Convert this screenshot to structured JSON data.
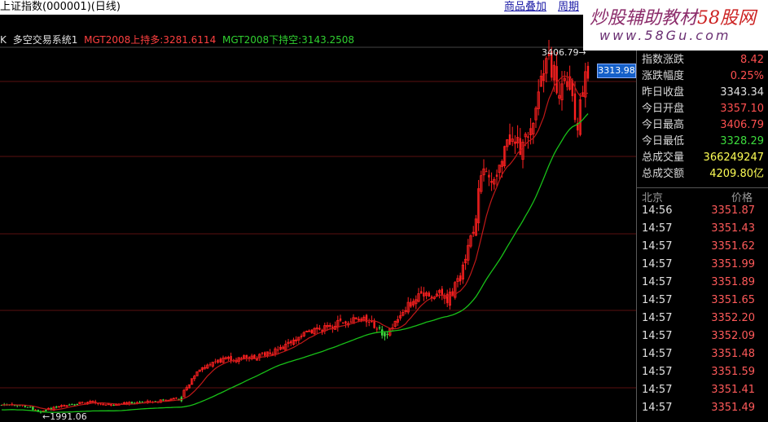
{
  "title_bar": {
    "title": "上证指数(000001)(日线)",
    "overlay_button": "商品叠加",
    "period_button": "周期"
  },
  "indicator": {
    "prefix": "K",
    "name": "多空交易系统1",
    "up_label": "MGT2008上持多:3281.6114",
    "down_label": "MGT2008下持空:3143.2508"
  },
  "chart_labels": {
    "high_marker": "3406.79→",
    "low_marker": "←1991.06",
    "last_price_tag": "3313.98"
  },
  "watermark": {
    "line1_a": "炒股辅助教材",
    "line1_b": "58股网",
    "line2": "www.58Gu.com"
  },
  "stats": [
    {
      "label": "指数涨跌",
      "value": "8.42",
      "color": "#ff5050"
    },
    {
      "label": "涨跌幅度",
      "value": "0.25%",
      "color": "#ff5050"
    },
    {
      "label": "昨日收盘",
      "value": "3343.34",
      "color": "#e0e0e0"
    },
    {
      "label": "今日开盘",
      "value": "3357.10",
      "color": "#ff5050"
    },
    {
      "label": "今日最高",
      "value": "3406.79",
      "color": "#ff5050"
    },
    {
      "label": "今日最低",
      "value": "3328.29",
      "color": "#3ddc3d"
    },
    {
      "label": "总成交量",
      "value": "366249247",
      "color": "#ffff55"
    },
    {
      "label": "总成交额",
      "value": "4209.80亿",
      "color": "#ffff55"
    }
  ],
  "ticks": {
    "header_left": "北京",
    "header_right": "价格",
    "rows": [
      {
        "time": "14:56",
        "price": "3351.87"
      },
      {
        "time": "14:57",
        "price": "3351.43"
      },
      {
        "time": "14:57",
        "price": "3351.62"
      },
      {
        "time": "14:57",
        "price": "3351.99"
      },
      {
        "time": "14:57",
        "price": "3351.89"
      },
      {
        "time": "14:57",
        "price": "3351.65"
      },
      {
        "time": "14:57",
        "price": "3352.20"
      },
      {
        "time": "14:57",
        "price": "3352.09"
      },
      {
        "time": "14:57",
        "price": "3351.48"
      },
      {
        "time": "14:57",
        "price": "3351.59"
      },
      {
        "time": "14:57",
        "price": "3351.41"
      },
      {
        "time": "14:57",
        "price": "3351.49"
      }
    ]
  },
  "colors": {
    "up_candle": "#ff2020",
    "down_candle": "#40e040",
    "ma_fast": "#c01818",
    "ma_slow": "#18c018",
    "indicator_up": "#ff4040",
    "indicator_down": "#30d030",
    "grid": "#5a1010"
  }
}
